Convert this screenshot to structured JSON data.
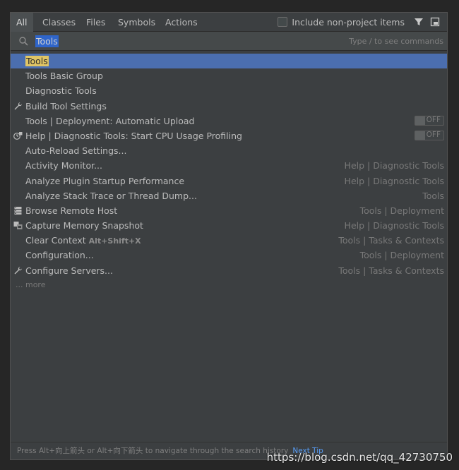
{
  "tabs": [
    {
      "label": "All",
      "active": true
    },
    {
      "label": "Classes",
      "active": false
    },
    {
      "label": "Files",
      "active": false
    },
    {
      "label": "Symbols",
      "active": false
    },
    {
      "label": "Actions",
      "active": false
    }
  ],
  "include_non_project": {
    "label": "Include non-project items",
    "checked": false
  },
  "header_icons": [
    "filter-icon",
    "preview-icon"
  ],
  "search": {
    "value": "Tools",
    "hint": "Type / to see commands"
  },
  "results": [
    {
      "label": "Tools",
      "location": "",
      "icon": "",
      "selected": true,
      "highlight": "Tools"
    },
    {
      "label": "Tools Basic Group",
      "location": "",
      "icon": ""
    },
    {
      "label": "Diagnostic Tools",
      "location": "",
      "icon": ""
    },
    {
      "label": "Build Tool Settings",
      "location": "",
      "icon": "wrench-icon"
    },
    {
      "label": "Tools | Deployment: Automatic Upload",
      "location": "",
      "icon": "",
      "toggle": "OFF"
    },
    {
      "label": "Help | Diagnostic Tools: Start CPU Usage Profiling",
      "location": "",
      "icon": "cpu-profiler-icon",
      "toggle": "OFF"
    },
    {
      "label": "Auto-Reload Settings...",
      "location": "",
      "icon": ""
    },
    {
      "label": "Activity Monitor...",
      "location": "Help | Diagnostic Tools",
      "icon": ""
    },
    {
      "label": "Analyze Plugin Startup Performance",
      "location": "Help | Diagnostic Tools",
      "icon": ""
    },
    {
      "label": "Analyze Stack Trace or Thread Dump...",
      "location": "Tools",
      "icon": ""
    },
    {
      "label": "Browse Remote Host",
      "location": "Tools | Deployment",
      "icon": "server-icon"
    },
    {
      "label": "Capture Memory Snapshot",
      "location": "Help | Diagnostic Tools",
      "icon": "memory-snapshot-icon"
    },
    {
      "label": "Clear Context",
      "shortcut": "Alt+Shift+X",
      "location": "Tools | Tasks & Contexts",
      "icon": ""
    },
    {
      "label": "Configuration...",
      "location": "Tools | Deployment",
      "icon": ""
    },
    {
      "label": "Configure Servers...",
      "location": "Tools | Tasks & Contexts",
      "icon": "wrench-icon"
    }
  ],
  "more_label": "... more",
  "footer": {
    "text": "Press Alt+向上箭头 or Alt+向下箭头 to navigate through the search history",
    "link": "Next Tip"
  },
  "watermark": "https://blog.csdn.net/qq_42730750",
  "colors": {
    "background": "#3c3f41",
    "selection": "#4b6eaf",
    "search_selection": "#2f65ca",
    "match_highlight": "#e0c565",
    "link": "#589df6"
  }
}
